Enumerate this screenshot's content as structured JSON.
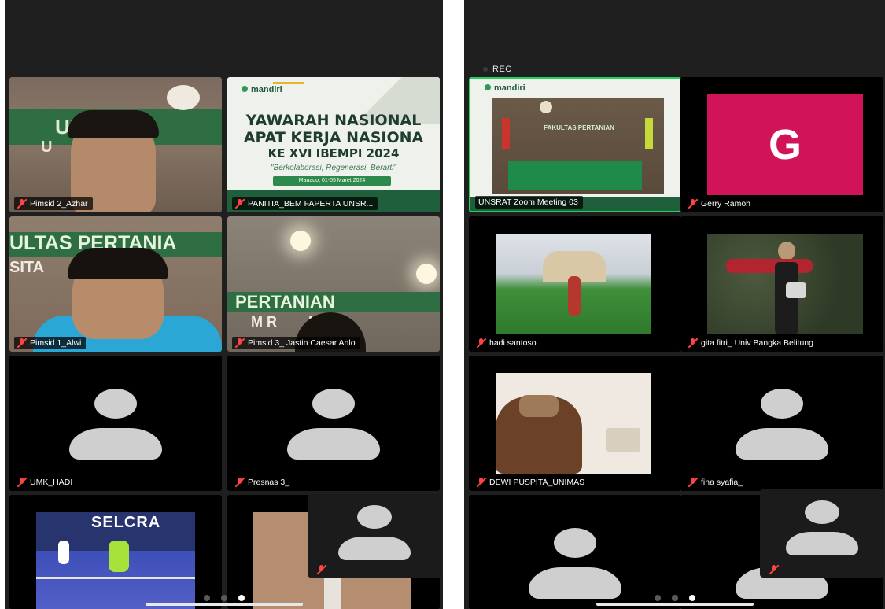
{
  "left_screen": {
    "tiles": [
      {
        "name": "Pimsid 2_Azhar"
      },
      {
        "name": "PANITIA_BEM FAPERTA UNSR..."
      },
      {
        "name": "Pimsid 1_Alwi"
      },
      {
        "name": "Pimsid 3_ Jastin Caesar Anlo"
      },
      {
        "name": "UMK_HADI"
      },
      {
        "name": "Presnas 3_"
      }
    ],
    "slide": {
      "logo": "mandiri",
      "line1": "YAWARAH NASIONAL",
      "line2": "APAT KERJA NASIONA",
      "line3": "KE XVI IBEMPI 2024",
      "tagline": "\"Berkolaborasi, Regenerasi, Berarti\"",
      "badge": "Manado, 01-05 Maret 2024"
    },
    "wall_text_1": "ULTAS PE",
    "wall_text_2": "U     AS SA",
    "wall_text_3": "ULTAS PERTANIA",
    "wall_text_4": "SITA          TULA",
    "wall_text_5": "PERTANIAN",
    "wall_text_6": "M R        NGI",
    "banner_text": "SELCRA"
  },
  "right_screen": {
    "recording_label": "REC",
    "tiles": [
      {
        "name": "UNSRAT Zoom Meeting 03",
        "active": true
      },
      {
        "name": "Gerry Ramoh",
        "initial": "G"
      },
      {
        "name": "hadi santoso"
      },
      {
        "name": "gita fitri_ Univ Bangka Belitung"
      },
      {
        "name": "DEWI PUSPITA_UNIMAS"
      },
      {
        "name": "fina syafia_"
      }
    ],
    "stage_logo": "mandiri",
    "stage_sign": "FAKULTAS PERTANIAN"
  },
  "colors": {
    "active_border": "#1fd25a",
    "mic_off": "#ff4444",
    "tile_bg": "#000000",
    "gerry_avatar": "#d1145a"
  },
  "pager": {
    "left_active_index": 2,
    "right_active_index": 2
  }
}
